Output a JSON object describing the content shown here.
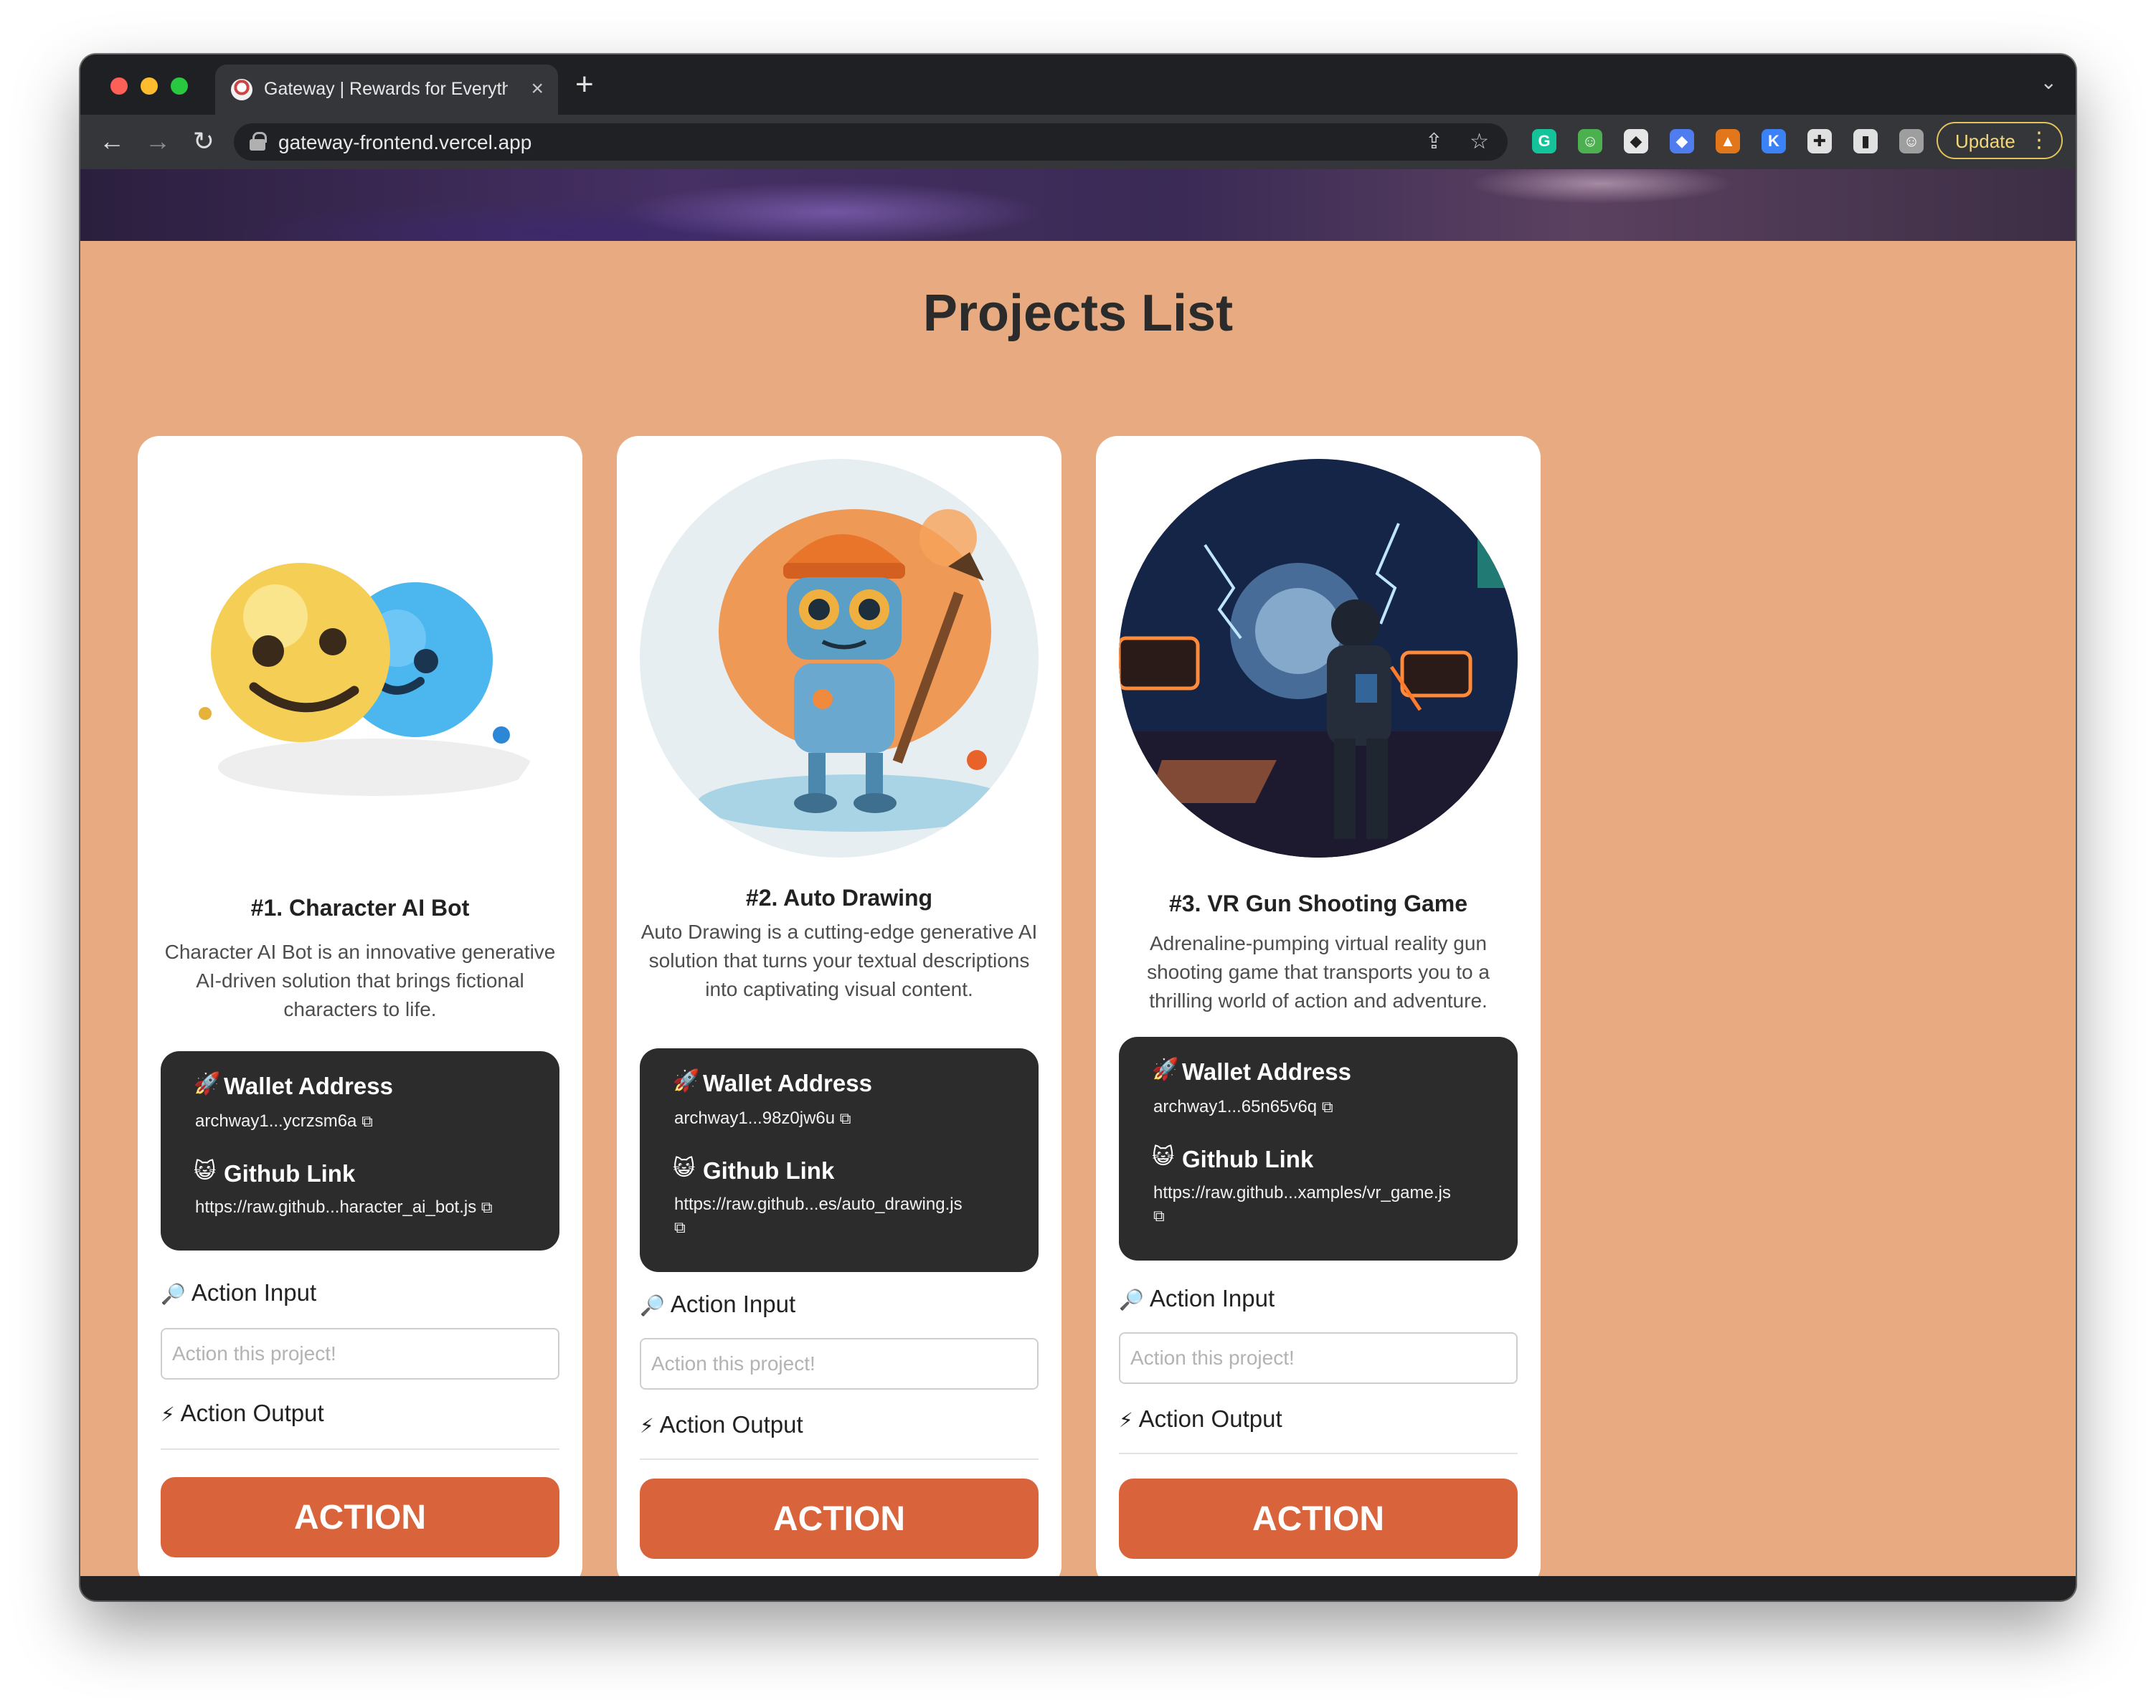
{
  "browser": {
    "tab_title": "Gateway | Rewards for Everything",
    "tab_close": "×",
    "new_tab": "+",
    "tab_search": "⌄",
    "url": "gateway-frontend.vercel.app",
    "update_label": "Update",
    "update_menu": "⋮",
    "nav": {
      "back": "←",
      "forward": "→",
      "reload": "↻"
    },
    "omnibox_icons": {
      "share": "⇪",
      "star": "☆"
    },
    "extensions": [
      {
        "name": "grammarly-extension-icon",
        "glyph": "G",
        "color": "#15c39a"
      },
      {
        "name": "robot-extension-icon",
        "glyph": "☺",
        "color": "#4caf50"
      },
      {
        "name": "shield-extension-icon",
        "glyph": "◆",
        "color": "#e6e6e6"
      },
      {
        "name": "gem-extension-icon",
        "glyph": "◆",
        "color": "#4f7df0"
      },
      {
        "name": "metamask-fox-icon",
        "glyph": "▲",
        "color": "#e2761b"
      },
      {
        "name": "keplr-extension-icon",
        "glyph": "K",
        "color": "#3b82f6"
      },
      {
        "name": "puzzle-extensions-icon",
        "glyph": "✚",
        "color": "#e0e0e0"
      },
      {
        "name": "side-panel-icon",
        "glyph": "▮",
        "color": "#e0e0e0"
      },
      {
        "name": "profile-avatar-icon",
        "glyph": "☺",
        "color": "#9e9e9e"
      }
    ]
  },
  "page": {
    "title": "Projects List"
  },
  "labels": {
    "wallet_emoji": "🚀",
    "wallet_heading": "Wallet Address",
    "github_emoji": "😺",
    "github_heading": "Github Link",
    "copy_glyph": "⧉",
    "input_emoji": "🔎",
    "input_label": "Action Input",
    "output_emoji": "⚡",
    "output_label": "Action Output",
    "input_placeholder": "Action this project!",
    "button_label": "ACTION"
  },
  "projects": [
    {
      "title": "#1. Character AI Bot",
      "description": "Character AI Bot is an innovative generative AI-driven solution that brings fictional characters to life.",
      "wallet": "archway1...ycrzsm6a",
      "github": "https://raw.github...haracter_ai_bot.js",
      "image": "two-smiling-emoji-balls"
    },
    {
      "title": "#2. Auto Drawing",
      "description": "Auto Drawing is a cutting-edge generative AI solution that turns your textual descriptions into captivating visual content.",
      "wallet": "archway1...98z0jw6u",
      "github": "https://raw.github...es/auto_drawing.js",
      "image": "painter-robot-with-brush"
    },
    {
      "title": "#3. VR Gun Shooting Game",
      "description": "Adrenaline-pumping virtual reality gun shooting game that transports you to a thrilling world of action and adventure.",
      "wallet": "archway1...65n65v6q",
      "github": "https://raw.github...xamples/vr_game.js",
      "image": "armored-soldier-in-neon-room"
    }
  ]
}
